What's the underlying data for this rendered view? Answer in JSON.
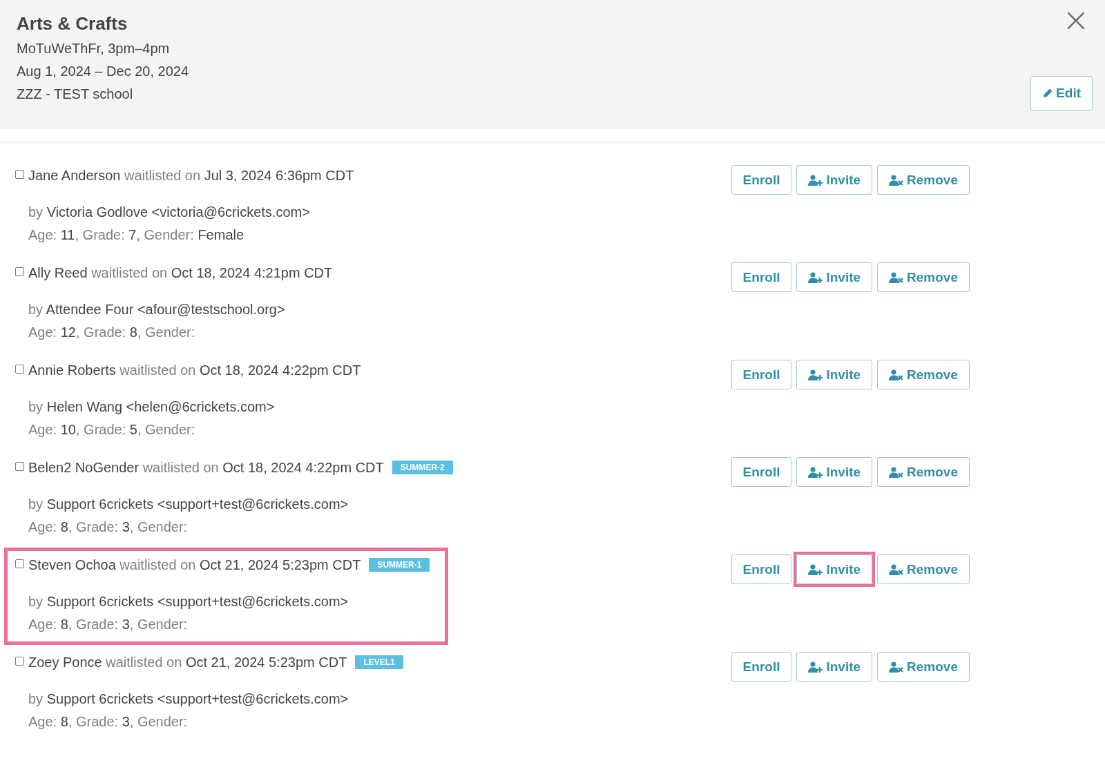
{
  "header": {
    "title": "Arts & Crafts",
    "lines": [
      "MoTuWeThFr, 3pm–4pm",
      "Aug 1, 2024 – Dec 20, 2024",
      "ZZZ - TEST school"
    ],
    "close": "×",
    "edit_button": "Edit"
  },
  "entries": [
    {
      "checked": false,
      "name": "Jane Anderson",
      "status": "waitlisted on",
      "date": "Jul 3, 2024 6:36pm CDT",
      "by_label": "by",
      "by": "Victoria Godlove <victoria@6crickets.com>",
      "details": [
        {
          "label": "Age:",
          "value": "11"
        },
        {
          "label": ", Grade:",
          "value": "7"
        },
        {
          "label": ", Gender:",
          "value": "Female"
        }
      ],
      "highlighted": false,
      "buttons": [
        {
          "kind": "enroll",
          "label": "Enroll",
          "highlighted": false
        },
        {
          "kind": "invite",
          "label": "Invite",
          "highlighted": false
        },
        {
          "kind": "remove",
          "label": "Remove",
          "highlighted": false
        }
      ]
    },
    {
      "checked": false,
      "name": "Ally Reed",
      "status": "waitlisted on",
      "date": "Oct 18, 2024 4:21pm CDT",
      "by_label": "by",
      "by": "Attendee Four <afour@testschool.org>",
      "details": [
        {
          "label": "Age:",
          "value": "12"
        },
        {
          "label": ", Grade:",
          "value": "8"
        },
        {
          "label": ", Gender:"
        }
      ],
      "highlighted": false,
      "buttons": [
        {
          "kind": "enroll",
          "label": "Enroll",
          "highlighted": false
        },
        {
          "kind": "invite",
          "label": "Invite",
          "highlighted": false
        },
        {
          "kind": "remove",
          "label": "Remove",
          "highlighted": false
        }
      ]
    },
    {
      "checked": false,
      "name": "Annie Roberts",
      "status": "waitlisted on",
      "date": "Oct 18, 2024 4:22pm CDT",
      "by_label": "by",
      "by": "Helen Wang <helen@6crickets.com>",
      "details": [
        {
          "label": "Age:",
          "value": "10"
        },
        {
          "label": ", Grade:",
          "value": "5"
        },
        {
          "label": ", Gender:"
        }
      ],
      "highlighted": false,
      "buttons": [
        {
          "kind": "enroll",
          "label": "Enroll",
          "highlighted": false
        },
        {
          "kind": "invite",
          "label": "Invite",
          "highlighted": false
        },
        {
          "kind": "remove",
          "label": "Remove",
          "highlighted": false
        }
      ]
    },
    {
      "checked": false,
      "name": "Belen2 NoGender",
      "status": "waitlisted on",
      "date": "Oct 18, 2024 4:22pm CDT",
      "badge": "SUMMER-2",
      "by_label": "by",
      "by": "Support 6crickets <support+test@6crickets.com>",
      "details": [
        {
          "label": "Age:",
          "value": "8"
        },
        {
          "label": ", Grade:",
          "value": "3"
        },
        {
          "label": ", Gender:"
        }
      ],
      "highlighted": false,
      "buttons": [
        {
          "kind": "enroll",
          "label": "Enroll",
          "highlighted": false
        },
        {
          "kind": "invite",
          "label": "Invite",
          "highlighted": false
        },
        {
          "kind": "remove",
          "label": "Remove",
          "highlighted": false
        }
      ]
    },
    {
      "checked": false,
      "name": "Steven Ochoa",
      "status": "waitlisted on",
      "date": "Oct 21, 2024 5:23pm CDT",
      "badge": "SUMMER-1",
      "by_label": "by",
      "by": "Support 6crickets <support+test@6crickets.com>",
      "details": [
        {
          "label": "Age:",
          "value": "8"
        },
        {
          "label": ", Grade:",
          "value": "3"
        },
        {
          "label": ", Gender:"
        }
      ],
      "highlighted": true,
      "buttons": [
        {
          "kind": "enroll",
          "label": "Enroll",
          "highlighted": false
        },
        {
          "kind": "invite",
          "label": "Invite",
          "highlighted": true
        },
        {
          "kind": "remove",
          "label": "Remove",
          "highlighted": false
        }
      ]
    },
    {
      "checked": false,
      "name": "Zoey Ponce",
      "status": "waitlisted on",
      "date": "Oct 21, 2024 5:23pm CDT",
      "badge": "LEVEL1",
      "by_label": "by",
      "by": "Support 6crickets <support+test@6crickets.com>",
      "details": [
        {
          "label": "Age:",
          "value": "8"
        },
        {
          "label": ", Grade:",
          "value": "3"
        },
        {
          "label": ", Gender:"
        }
      ],
      "highlighted": false,
      "buttons": [
        {
          "kind": "enroll",
          "label": "Enroll",
          "highlighted": false
        },
        {
          "kind": "invite",
          "label": "Invite",
          "highlighted": false
        },
        {
          "kind": "remove",
          "label": "Remove",
          "highlighted": false
        }
      ]
    }
  ]
}
